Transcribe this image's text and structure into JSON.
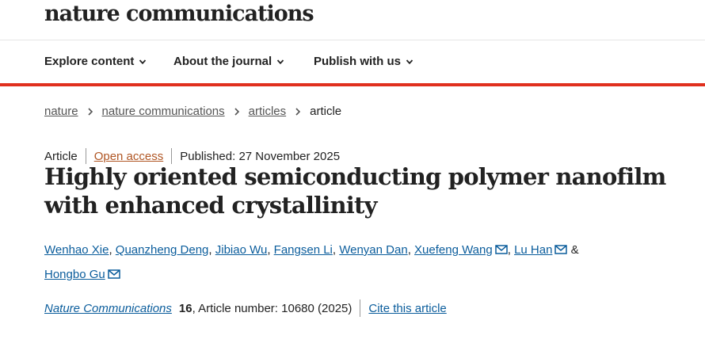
{
  "site": {
    "logo_text": "nature communications"
  },
  "nav": {
    "items": [
      {
        "label": "Explore content"
      },
      {
        "label": "About the journal"
      },
      {
        "label": "Publish with us"
      }
    ]
  },
  "breadcrumb": {
    "items": [
      {
        "label": "nature"
      },
      {
        "label": "nature communications"
      },
      {
        "label": "articles"
      }
    ],
    "current": "article"
  },
  "article": {
    "type": "Article",
    "access": "Open access",
    "published": "Published: 27 November 2025",
    "title": "Highly oriented semiconducting polymer nanofilm with enhanced crystallinity",
    "authors": [
      {
        "name": "Wenhao Xie"
      },
      {
        "name": "Quanzheng Deng"
      },
      {
        "name": "Jibiao Wu"
      },
      {
        "name": "Fangsen Li"
      },
      {
        "name": "Wenyan Dan"
      },
      {
        "name": "Xuefeng Wang"
      },
      {
        "name": "Lu Han"
      },
      {
        "name": "Hongbo Gu"
      }
    ],
    "author_comma": ", ",
    "author_amp": " & ",
    "journal": "Nature Communications",
    "volume": "16",
    "article_number": ", Article number: 10680 (2025)",
    "cite_label": "Cite this article"
  },
  "icons": {
    "nav_dropdown": "chevron-down-icon",
    "breadcrumb_sep": "chevron-right-icon",
    "corresponding": "mail-icon"
  },
  "colors": {
    "accent_red": "#e0301e",
    "link_blue": "#0b5d9c",
    "open_access": "#b05624"
  }
}
